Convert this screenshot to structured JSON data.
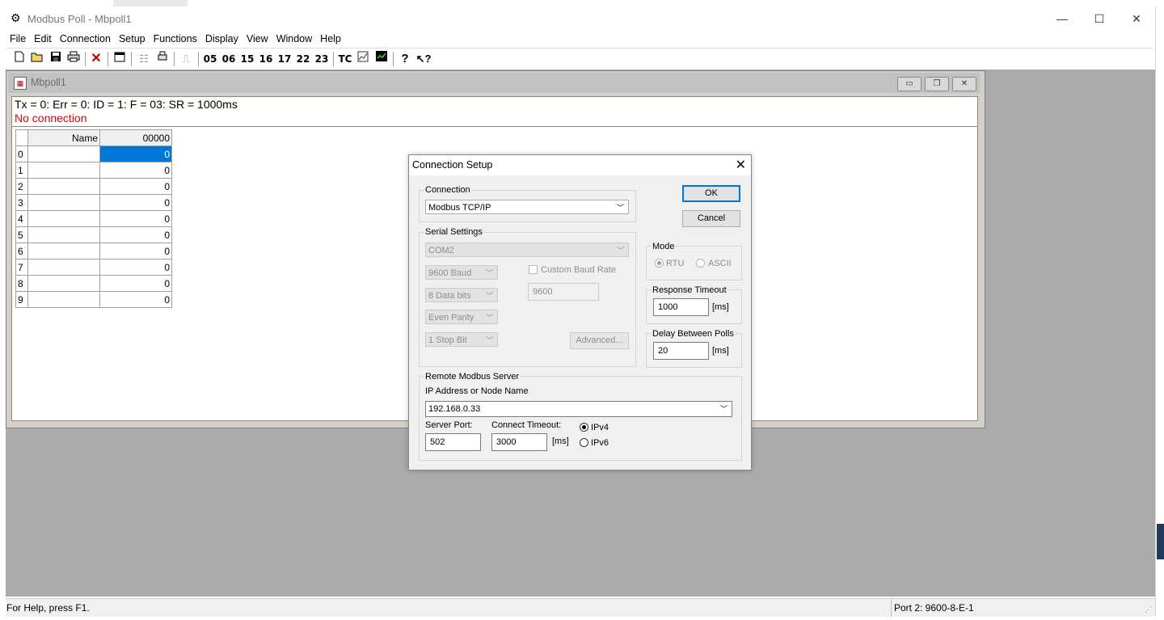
{
  "window": {
    "title": "Modbus Poll - Mbpoll1",
    "minimize": "—",
    "maximize": "☐",
    "close": "✕"
  },
  "menu": [
    "File",
    "Edit",
    "Connection",
    "Setup",
    "Functions",
    "Display",
    "View",
    "Window",
    "Help"
  ],
  "toolbar": {
    "function_codes": [
      "05",
      "06",
      "15",
      "16",
      "17",
      "22",
      "23"
    ],
    "tc_label": "TC"
  },
  "child": {
    "title": "Mbpoll1",
    "status_line": "Tx = 0: Err = 0: ID = 1: F = 03: SR = 1000ms",
    "connection_status": "No connection",
    "grid": {
      "col_name": "Name",
      "col_addr": "00000",
      "rows": [
        {
          "idx": "0",
          "name": "",
          "value": "0"
        },
        {
          "idx": "1",
          "name": "",
          "value": "0"
        },
        {
          "idx": "2",
          "name": "",
          "value": "0"
        },
        {
          "idx": "3",
          "name": "",
          "value": "0"
        },
        {
          "idx": "4",
          "name": "",
          "value": "0"
        },
        {
          "idx": "5",
          "name": "",
          "value": "0"
        },
        {
          "idx": "6",
          "name": "",
          "value": "0"
        },
        {
          "idx": "7",
          "name": "",
          "value": "0"
        },
        {
          "idx": "8",
          "name": "",
          "value": "0"
        },
        {
          "idx": "9",
          "name": "",
          "value": "0"
        }
      ]
    }
  },
  "dialog": {
    "title": "Connection Setup",
    "connection_group": "Connection",
    "connection_value": "Modbus TCP/IP",
    "ok": "OK",
    "cancel": "Cancel",
    "serial_group": "Serial Settings",
    "port": "COM2",
    "baud": "9600 Baud",
    "data_bits": "8 Data bits",
    "parity": "Even Parity",
    "stop_bits": "1 Stop Bit",
    "custom_baud_label": "Custom Baud Rate",
    "custom_baud_value": "9600",
    "advanced": "Advanced...",
    "mode_group": "Mode",
    "mode_rtu": "RTU",
    "mode_ascii": "ASCII",
    "response_timeout_group": "Response Timeout",
    "response_timeout_value": "1000",
    "delay_group": "Delay Between Polls",
    "delay_value": "20",
    "ms_unit": "[ms]",
    "remote_group": "Remote Modbus Server",
    "ip_label": "IP Address or Node Name",
    "ip_value": "192.168.0.33",
    "server_port_label": "Server Port:",
    "server_port_value": "502",
    "connect_timeout_label": "Connect Timeout:",
    "connect_timeout_value": "3000",
    "ipv4": "IPv4",
    "ipv6": "IPv6"
  },
  "statusbar": {
    "help": "For Help, press F1.",
    "port_info": "Port 2: 9600-8-E-1"
  }
}
